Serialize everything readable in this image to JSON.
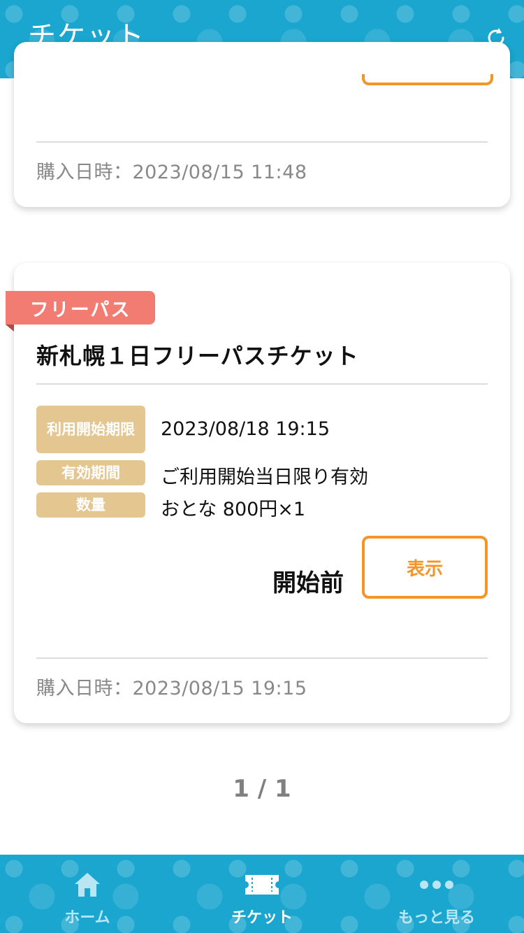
{
  "header": {
    "title": "チケット",
    "refresh_icon": "refresh-icon"
  },
  "tickets": [
    {
      "purchase_label": "購入日時：2023/08/15 11:48"
    },
    {
      "badge": "フリーパス",
      "title": "新札幌１日フリーパスチケット",
      "rows": [
        {
          "label": "利用開始期限",
          "value": "2023/08/18 19:15"
        },
        {
          "label": "有効期間",
          "value": "ご利用開始当日限り有効"
        },
        {
          "label": "数量",
          "value": "おとな 800円×1"
        }
      ],
      "status": "開始前",
      "show_button": "表示",
      "purchase_label": "購入日時：2023/08/15 19:15"
    }
  ],
  "pagination": "1 / 1",
  "nav": {
    "items": [
      {
        "label": "ホーム",
        "icon": "home-icon",
        "active": false
      },
      {
        "label": "チケット",
        "icon": "ticket-icon",
        "active": true
      },
      {
        "label": "もっと見る",
        "icon": "more-icon",
        "active": false
      }
    ]
  },
  "colors": {
    "header_bg": "#1aa6cf",
    "badge": "#f27b72",
    "label_bg": "#e3c690",
    "accent": "#f39527"
  }
}
